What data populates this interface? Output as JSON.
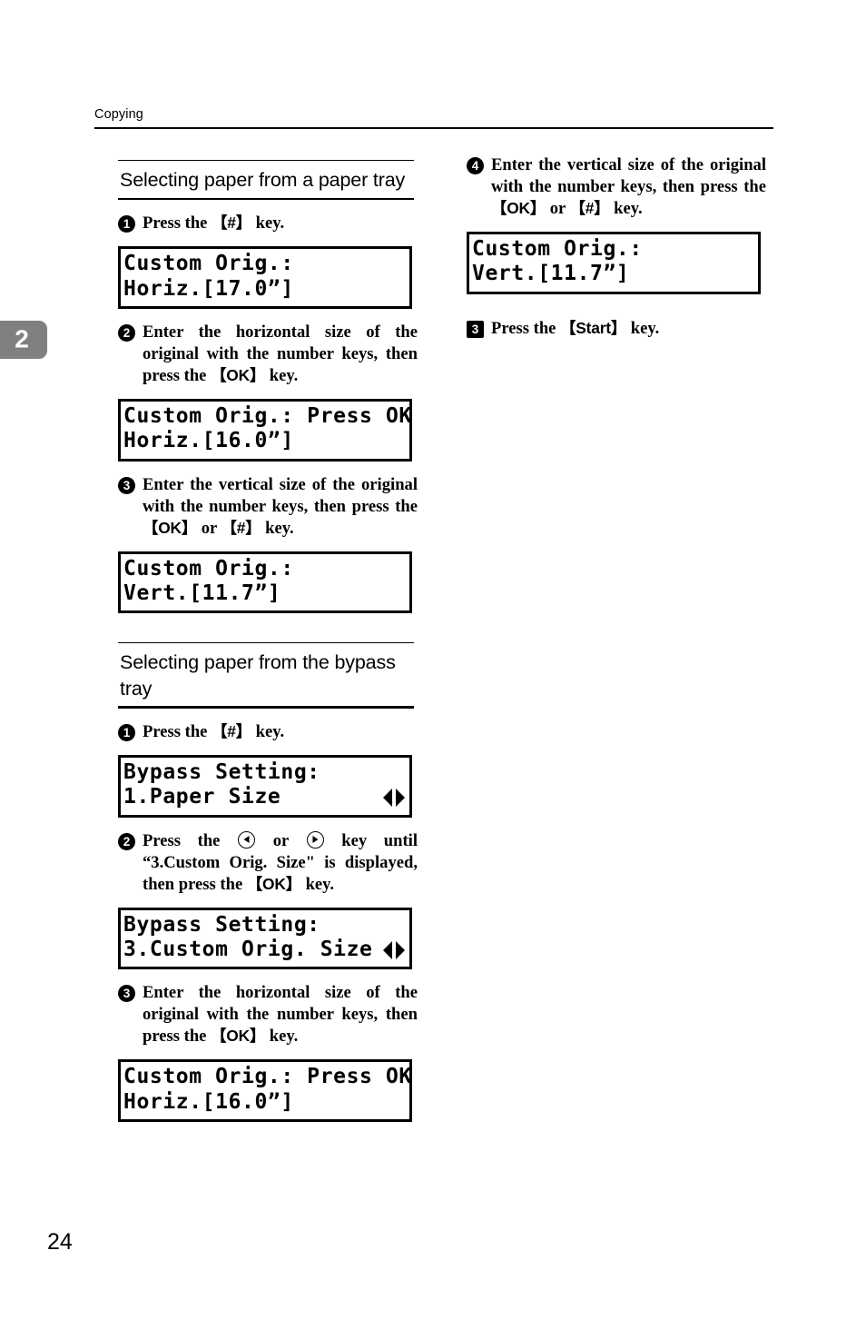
{
  "running_head": "Copying",
  "chapter_tab": {
    "number": "2",
    "color": "#808080"
  },
  "page_number": "24",
  "left_column": {
    "sections": [
      {
        "title": "Selecting paper from a paper tray",
        "steps": [
          {
            "marker": "1",
            "marker_shape": "circle",
            "text_parts": [
              {
                "type": "text",
                "value": "Press the "
              },
              {
                "type": "keycap",
                "value": "#"
              },
              {
                "type": "text",
                "value": " key."
              }
            ],
            "plain_text": "Press the 【#】 key.",
            "lcd": {
              "line1": "Custom Orig.:",
              "line2": "Horiz.[17.0”]",
              "arrows": false
            }
          },
          {
            "marker": "2",
            "marker_shape": "circle",
            "plain_text": "Enter the horizontal size of the original with the number keys, then press the 【OK】 key.",
            "text_parts": [
              {
                "type": "text",
                "value": "Enter the horizontal size of the original with the number keys, then press the "
              },
              {
                "type": "keycap",
                "value": "OK"
              },
              {
                "type": "text",
                "value": " key."
              }
            ],
            "lcd": {
              "line1": "Custom Orig.: Press OK",
              "line2": "Horiz.[16.0”]",
              "arrows": false
            }
          },
          {
            "marker": "3",
            "marker_shape": "circle",
            "plain_text": "Enter the vertical size of the original with the number keys, then press the 【OK】 or 【#】 key.",
            "text_parts": [
              {
                "type": "text",
                "value": "Enter the vertical size of the original with the number keys, then press the "
              },
              {
                "type": "keycap",
                "value": "OK"
              },
              {
                "type": "text",
                "value": " or "
              },
              {
                "type": "keycap",
                "value": "#"
              },
              {
                "type": "text",
                "value": " key."
              }
            ],
            "lcd": {
              "line1": "Custom Orig.:",
              "line2": "Vert.[11.7”]",
              "arrows": false
            }
          }
        ]
      },
      {
        "title": "Selecting paper from the bypass tray",
        "steps": [
          {
            "marker": "1",
            "marker_shape": "circle",
            "plain_text": "Press the 【#】 key.",
            "text_parts": [
              {
                "type": "text",
                "value": "Press the "
              },
              {
                "type": "keycap",
                "value": "#"
              },
              {
                "type": "text",
                "value": " key."
              }
            ],
            "lcd": {
              "line1": "Bypass Setting:",
              "line2": "1.Paper Size",
              "arrows": true
            }
          },
          {
            "marker": "2",
            "marker_shape": "circle",
            "plain_text": "Press the ◁ or ▷ key until “3.Custom Orig. Size\" is displayed, then press the 【OK】 key.",
            "text_parts": [
              {
                "type": "text",
                "value": "Press the "
              },
              {
                "type": "arrowkey",
                "value": "left"
              },
              {
                "type": "text",
                "value": " or "
              },
              {
                "type": "arrowkey",
                "value": "right"
              },
              {
                "type": "text",
                "value": " key until “3.Custom Orig. Size\" is dis­played, then press the "
              },
              {
                "type": "keycap",
                "value": "OK"
              },
              {
                "type": "text",
                "value": " key."
              }
            ],
            "lcd": {
              "line1": "Bypass Setting:",
              "line2": "3.Custom Orig. Size",
              "arrows": true
            }
          },
          {
            "marker": "3",
            "marker_shape": "circle",
            "plain_text": "Enter the horizontal size of the original with the number keys, then press the 【OK】 key.",
            "text_parts": [
              {
                "type": "text",
                "value": "Enter the horizontal size of the original with the number keys, then press the "
              },
              {
                "type": "keycap",
                "value": "OK"
              },
              {
                "type": "text",
                "value": " key."
              }
            ],
            "lcd": {
              "line1": "Custom Orig.: Press OK",
              "line2": "Horiz.[16.0”]",
              "arrows": false
            }
          }
        ]
      }
    ]
  },
  "right_column": {
    "steps": [
      {
        "marker": "4",
        "marker_shape": "circle",
        "plain_text": "Enter the vertical size of the original with the number keys, then press the 【OK】 or 【#】 key.",
        "text_parts": [
          {
            "type": "text",
            "value": "Enter the vertical size of the original with the number keys, then press the "
          },
          {
            "type": "keycap",
            "value": "OK"
          },
          {
            "type": "text",
            "value": " or "
          },
          {
            "type": "keycap",
            "value": "#"
          },
          {
            "type": "text",
            "value": " key."
          }
        ],
        "lcd": {
          "line1": "Custom Orig.:",
          "line2": "Vert.[11.7”]",
          "arrows": false
        }
      },
      {
        "marker": "3",
        "marker_shape": "square",
        "plain_text": "Press the 【Start】 key.",
        "text_parts": [
          {
            "type": "text",
            "value": "Press the "
          },
          {
            "type": "keycap",
            "value": "Start"
          },
          {
            "type": "text",
            "value": " key."
          }
        ],
        "lcd": null
      }
    ]
  }
}
